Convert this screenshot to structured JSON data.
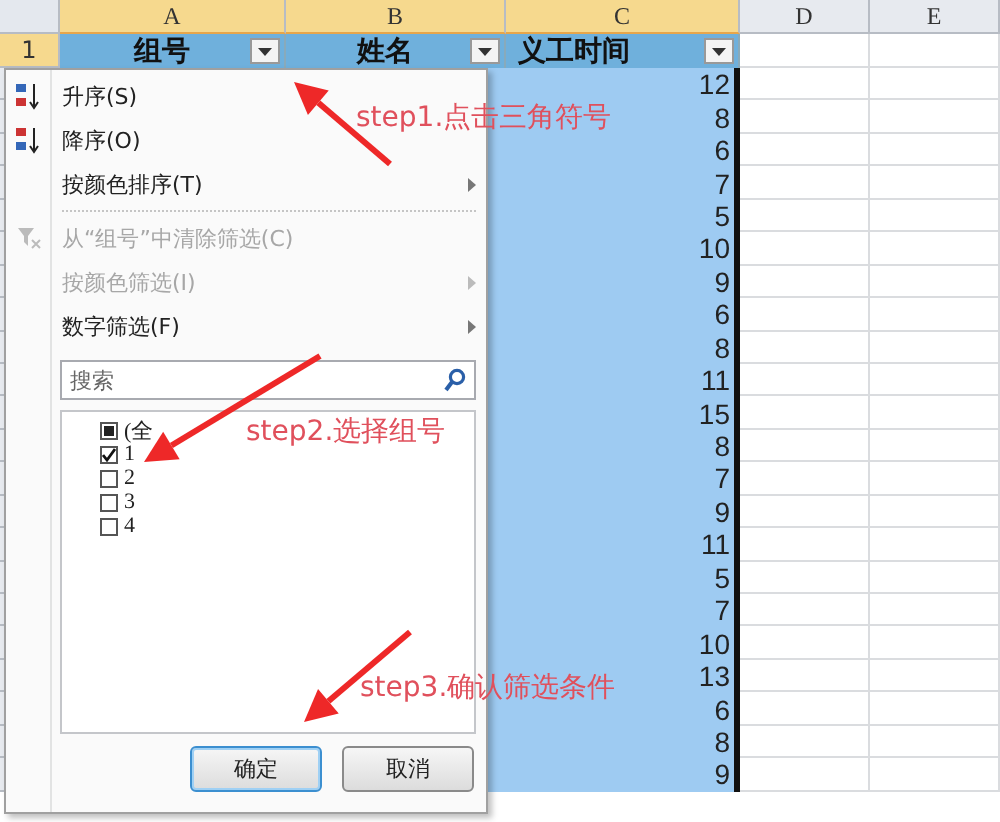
{
  "columns": [
    {
      "label": "A",
      "selected": true
    },
    {
      "label": "B",
      "selected": true
    },
    {
      "label": "C",
      "selected": true
    },
    {
      "label": "D",
      "selected": false
    },
    {
      "label": "E",
      "selected": false
    }
  ],
  "header_row": {
    "number": "1",
    "selected": true,
    "cells": [
      {
        "text": "组号",
        "filter": true
      },
      {
        "text": "姓名",
        "filter": true
      },
      {
        "text": "义工时间",
        "filter": true
      }
    ]
  },
  "values": [
    "12",
    "8",
    "6",
    "7",
    "5",
    "10",
    "9",
    "6",
    "8",
    "11",
    "15",
    "8",
    "7",
    "9",
    "11",
    "5",
    "7",
    "10",
    "13",
    "6",
    "8",
    "9"
  ],
  "filter_menu": {
    "items": [
      {
        "kind": "ascending",
        "label": "升序(S)",
        "disabled": false,
        "submenu": false
      },
      {
        "kind": "descending",
        "label": "降序(O)",
        "disabled": false,
        "submenu": false
      },
      {
        "kind": "item",
        "label": "按颜色排序(T)",
        "disabled": false,
        "submenu": true
      },
      {
        "kind": "separator"
      },
      {
        "kind": "clear",
        "label": "从“组号”中清除筛选(C)",
        "disabled": true,
        "submenu": false
      },
      {
        "kind": "item",
        "label": "按颜色筛选(I)",
        "disabled": true,
        "submenu": true
      },
      {
        "kind": "item",
        "label": "数字筛选(F)",
        "disabled": false,
        "submenu": true
      }
    ],
    "search": {
      "placeholder": "搜索"
    },
    "options": [
      {
        "label": "(全",
        "checked": false,
        "indeterminate": true
      },
      {
        "label": "1",
        "checked": true,
        "indeterminate": false
      },
      {
        "label": "2",
        "checked": false,
        "indeterminate": false
      },
      {
        "label": "3",
        "checked": false,
        "indeterminate": false
      },
      {
        "label": "4",
        "checked": false,
        "indeterminate": false
      }
    ],
    "buttons": [
      {
        "label": "确定",
        "default": true
      },
      {
        "label": "取消",
        "default": false
      }
    ]
  },
  "annotations": [
    {
      "text": "step1.点击三角符号"
    },
    {
      "text": "step2.选择组号"
    },
    {
      "text": "step3.确认筛选条件"
    }
  ]
}
